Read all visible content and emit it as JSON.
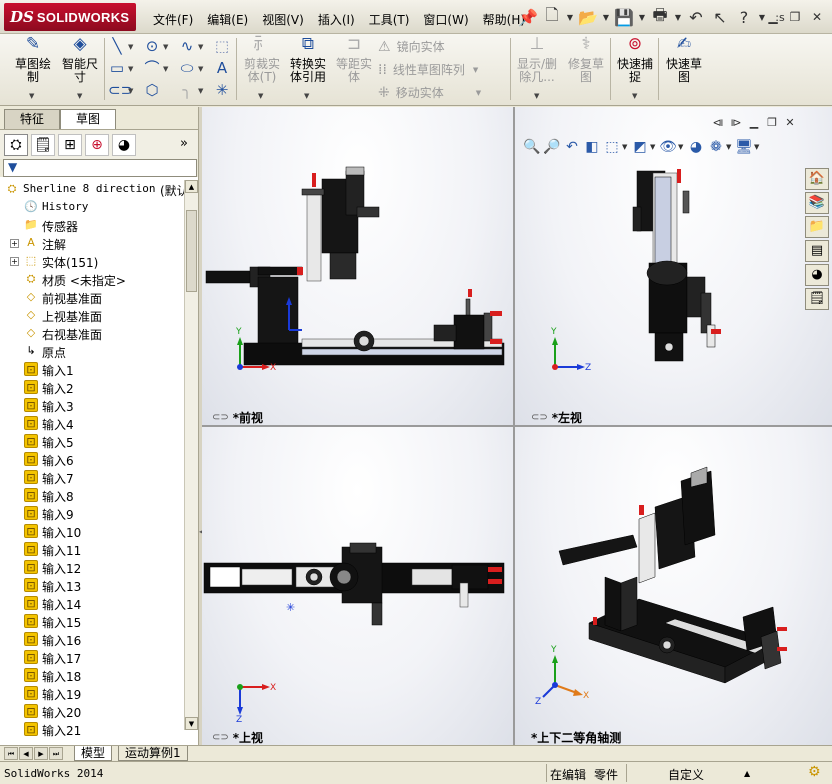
{
  "app": {
    "brand": "SOLIDWORKS",
    "brand_prefix": "DS"
  },
  "menu": [
    "文件(F)",
    "编辑(E)",
    "视图(V)",
    "插入(I)",
    "工具(T)",
    "窗口(W)",
    "帮助(H)"
  ],
  "ribbon": {
    "sketch": "草图绘\n制",
    "smart_dim": "智能尺\n寸",
    "trim": "剪裁实\n体(T)",
    "convert": "转换实\n体引用",
    "offset": "等距实\n体",
    "mirror": "镜向实体",
    "linear_pattern": "线性草图阵列",
    "move": "移动实体",
    "show_delete": "显示/删\n除几...",
    "repair": "修复草\n图",
    "quick_snap": "快速捕\n捉",
    "rapid_sketch": "快速草\n图"
  },
  "left_tabs": [
    "特征",
    "草图"
  ],
  "tree": {
    "root": "Sherline 8 direction",
    "root_suffix": "(默认",
    "items": [
      {
        "label": "History",
        "mono": true,
        "icon": "history-icon",
        "exp": false
      },
      {
        "label": "传感器",
        "icon": "sensor-icon",
        "exp": false
      },
      {
        "label": "注解",
        "icon": "annotation-icon",
        "exp": true
      },
      {
        "label": "实体(151)",
        "icon": "solid-bodies-icon",
        "exp": true
      },
      {
        "label": "材质 <未指定>",
        "icon": "material-icon",
        "exp": false
      },
      {
        "label": "前视基准面",
        "icon": "plane-icon",
        "exp": false
      },
      {
        "label": "上视基准面",
        "icon": "plane-icon",
        "exp": false
      },
      {
        "label": "右视基准面",
        "icon": "plane-icon",
        "exp": false
      },
      {
        "label": "原点",
        "icon": "origin-icon",
        "exp": false
      },
      {
        "label": "输入1"
      },
      {
        "label": "输入2"
      },
      {
        "label": "输入3"
      },
      {
        "label": "输入4"
      },
      {
        "label": "输入5"
      },
      {
        "label": "输入6"
      },
      {
        "label": "输入7"
      },
      {
        "label": "输入8"
      },
      {
        "label": "输入9"
      },
      {
        "label": "输入10"
      },
      {
        "label": "输入11"
      },
      {
        "label": "输入12"
      },
      {
        "label": "输入13"
      },
      {
        "label": "输入14"
      },
      {
        "label": "输入15"
      },
      {
        "label": "输入16"
      },
      {
        "label": "输入17"
      },
      {
        "label": "输入18"
      },
      {
        "label": "输入19"
      },
      {
        "label": "输入20"
      },
      {
        "label": "输入21"
      }
    ]
  },
  "viewports": {
    "front": "*前视",
    "left": "*左视",
    "top": "*上视",
    "iso": "*上下二等角轴测"
  },
  "axes": {
    "x": "X",
    "y": "Y",
    "z": "Z"
  },
  "bottom_tabs": [
    "模型",
    "运动算例1"
  ],
  "status": {
    "app": "SolidWorks 2014",
    "editing": "在编辑",
    "doc_type": "零件",
    "units": "自定义"
  },
  "colors": {
    "brand_red": "#c8102e",
    "x_axis": "#d81e1e",
    "y_axis": "#1aa01a",
    "z_axis": "#1a3ad8",
    "part_body": "#111111"
  }
}
